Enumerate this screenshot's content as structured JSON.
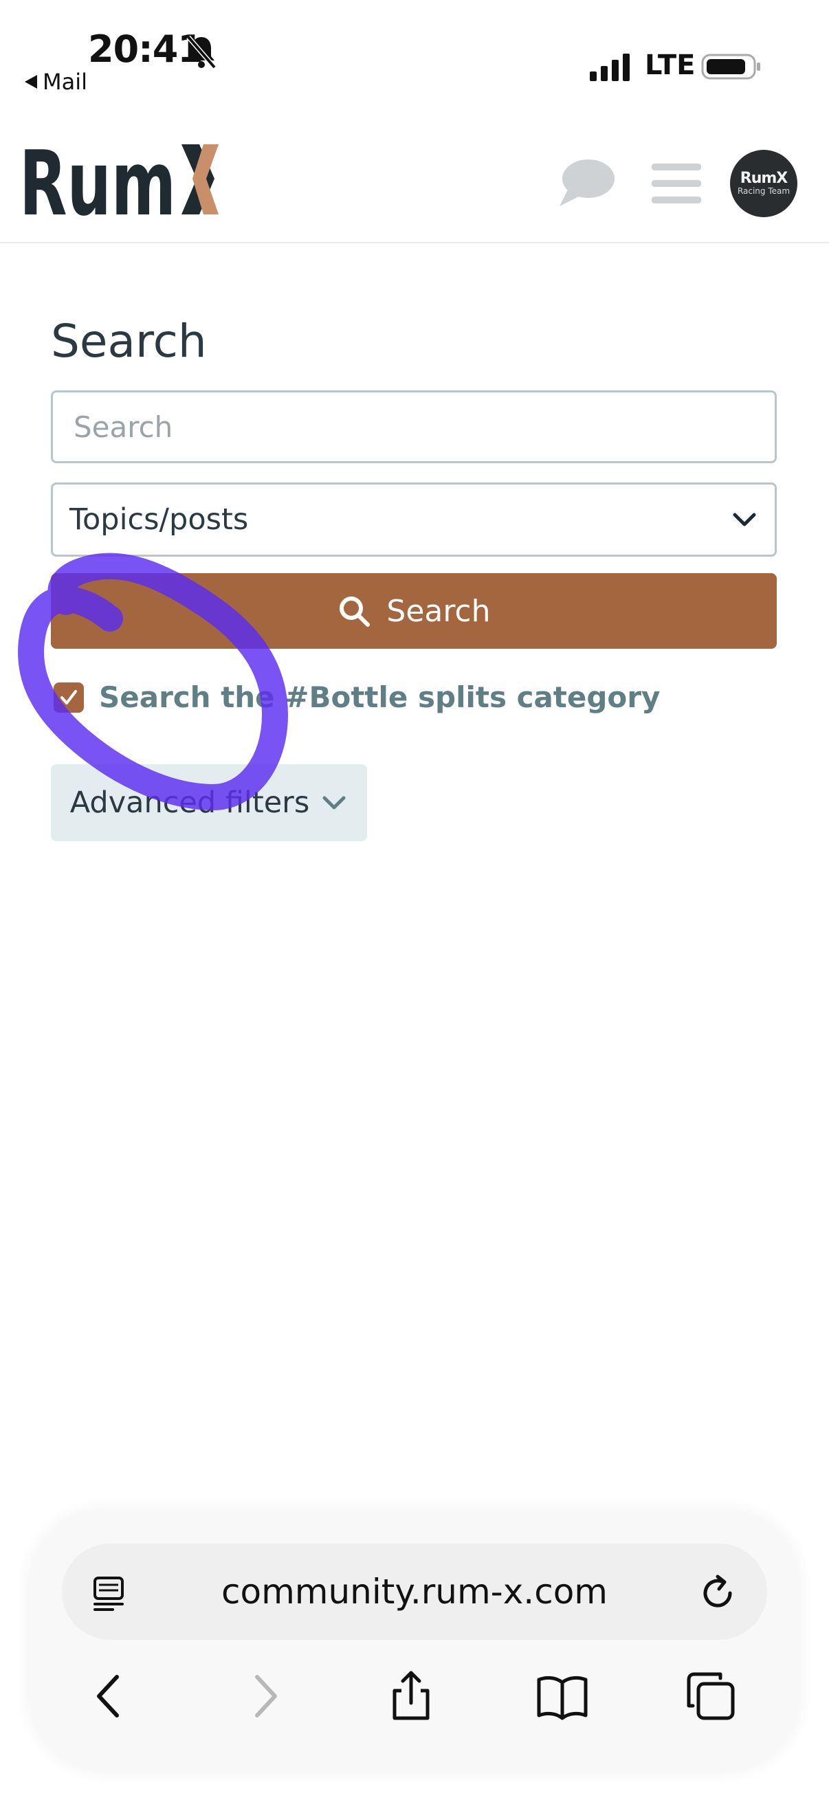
{
  "status_bar": {
    "time": "20:41",
    "back_app": "Mail",
    "carrier": "LTE"
  },
  "header": {
    "logo_text": "RumX",
    "logo_color": "#1f2b31",
    "logo_accent": "#c88f6a",
    "avatar_line1": "RumX",
    "avatar_line2": "Racing Team"
  },
  "search": {
    "title": "Search",
    "input_value": "",
    "input_placeholder": "Search",
    "type_select": "Topics/posts",
    "button_label": "Search",
    "checkbox_checked": true,
    "checkbox_label": "Search the #Bottle splits category",
    "advanced_label": "Advanced filters"
  },
  "browser": {
    "url": "community.rum-x.com"
  },
  "colors": {
    "accent": "#a3663e",
    "annotation": "#5b2df0",
    "label_teal": "#5f7f84"
  },
  "icons": {
    "bell": "bell-slash-icon",
    "chat": "chat-bubble-icon",
    "menu": "hamburger-menu-icon",
    "search": "magnifier-icon",
    "chevron": "chevron-down-icon",
    "reader": "reader-icon",
    "reload": "reload-icon",
    "back": "back-arrow-icon",
    "forward": "forward-arrow-icon",
    "share": "share-icon",
    "bookmarks": "bookmarks-icon",
    "tabs": "tabs-icon"
  }
}
